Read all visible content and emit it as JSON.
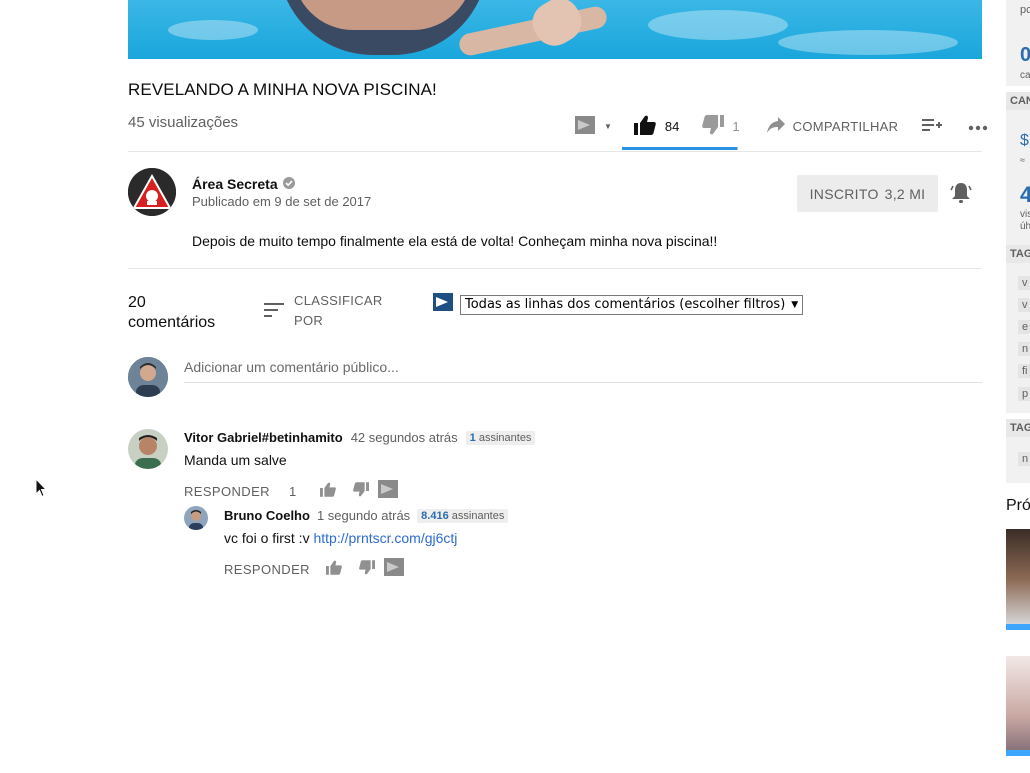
{
  "video": {
    "title": "REVELANDO A MINHA NOVA PISCINA!",
    "views": "45 visualizações",
    "likes": "84",
    "dislikes": "1",
    "like_ratio": 0.99,
    "share_label": "COMPARTILHAR"
  },
  "channel": {
    "name": "Área Secreta",
    "published": "Publicado em 9 de set de 2017",
    "subscribe_label": "INSCRITO",
    "subscriber_count": "3,2 MI",
    "description": "Depois de muito tempo finalmente ela está de volta! Conheçam minha nova piscina!!"
  },
  "comments_header": {
    "count_number": "20",
    "count_label": "comentários",
    "sort_label_1": "CLASSIFICAR",
    "sort_label_2": "POR",
    "filter_value": "Todas as linhas dos comentários (escolher filtros)",
    "add_placeholder": "Adicionar um comentário público..."
  },
  "comments": [
    {
      "author": "Vitor Gabriel#betinhamito",
      "time": "42 segundos atrás",
      "badge_count": "1",
      "badge_label": "assinantes",
      "text": "Manda um salve",
      "reply_label": "RESPONDER",
      "likes": "1"
    },
    {
      "author": "Bruno Coelho",
      "time": "1 segundo atrás",
      "badge_count": "8.416",
      "badge_label": "assinantes",
      "text": "vc foi o first :v",
      "link": "http://prntscr.com/gj6ctj",
      "reply_label": "RESPONDER"
    }
  ],
  "sidebar": {
    "texts": [
      "pc",
      "0",
      "ca",
      "CAN",
      "$",
      "≈",
      "4",
      "vis",
      "úh",
      "TAG",
      "v",
      "v",
      "e",
      "n",
      "fi",
      "p",
      "TAG",
      "n",
      "Pró"
    ]
  },
  "colors": {
    "accent": "#2793e6",
    "link": "#2c6bd2",
    "text_secondary": "#606060",
    "button_bg": "#ececec"
  }
}
